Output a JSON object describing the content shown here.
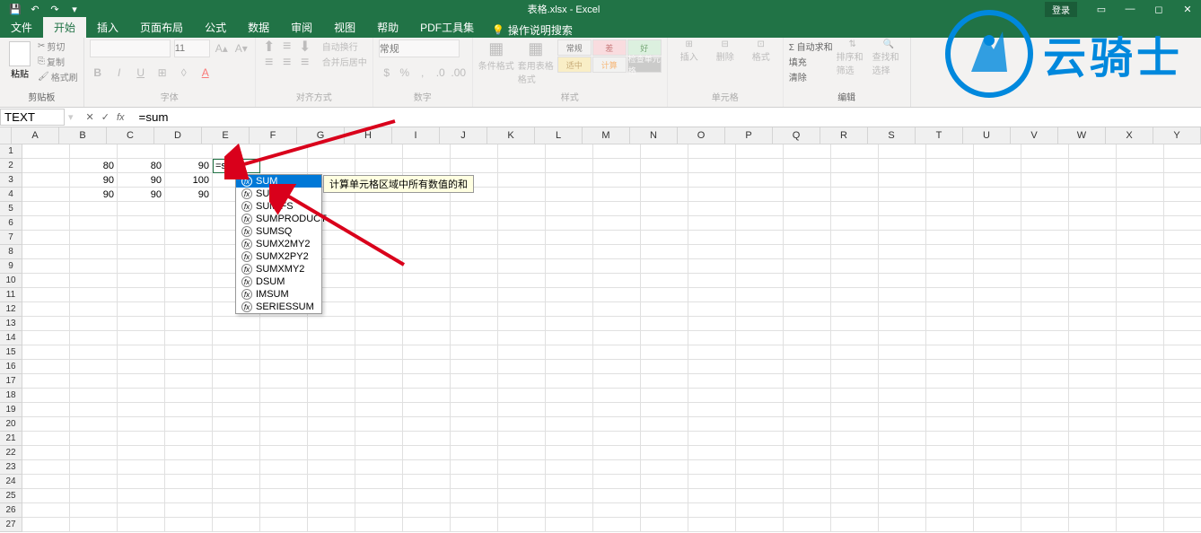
{
  "title": "表格.xlsx - Excel",
  "qat": {
    "save": "💾",
    "undo": "↶",
    "redo": "↷"
  },
  "login": "登录",
  "tabs": {
    "file": "文件",
    "home": "开始",
    "insert": "插入",
    "layout": "页面布局",
    "formulas": "公式",
    "data": "数据",
    "review": "审阅",
    "view": "视图",
    "help": "帮助",
    "pdf": "PDF工具集",
    "tellme": "操作说明搜索"
  },
  "ribbon": {
    "clipboard": {
      "label": "剪贴板",
      "paste": "粘贴",
      "cut": "剪切",
      "copy": "复制",
      "format": "格式刷"
    },
    "font": {
      "label": "字体",
      "size": "11"
    },
    "alignment": {
      "label": "对齐方式",
      "wrap": "自动换行",
      "merge": "合并后居中"
    },
    "number": {
      "label": "数字",
      "format": "常规"
    },
    "styles": {
      "label": "样式",
      "conditional": "条件格式",
      "table": "套用表格格式",
      "normal": "常规",
      "bad": "差",
      "good": "好",
      "neutral": "适中",
      "calc": "计算",
      "check": "检查单元格"
    },
    "cells": {
      "label": "单元格",
      "insert": "插入",
      "delete": "删除",
      "format": "格式"
    },
    "editing": {
      "label": "编辑",
      "sum": "Σ",
      "fill": "填充",
      "clear": "清除",
      "sort": "排序和筛选",
      "find": "查找和选择"
    }
  },
  "formula_bar": {
    "name_box": "TEXT",
    "formula": "=sum"
  },
  "columns": [
    "A",
    "B",
    "C",
    "D",
    "E",
    "F",
    "G",
    "H",
    "I",
    "J",
    "K",
    "L",
    "M",
    "N",
    "O",
    "P",
    "Q",
    "R",
    "S",
    "T",
    "U",
    "V",
    "W",
    "X",
    "Y"
  ],
  "rows": [
    1,
    2,
    3,
    4,
    5,
    6,
    7,
    8,
    9,
    10,
    11,
    12,
    13,
    14,
    15,
    16,
    17,
    18,
    19,
    20,
    21,
    22,
    23,
    24,
    25,
    26,
    27
  ],
  "grid_data": {
    "r2": {
      "B": "80",
      "C": "80",
      "D": "90",
      "E": "=sum"
    },
    "r3": {
      "B": "90",
      "C": "90",
      "D": "100"
    },
    "r4": {
      "B": "90",
      "C": "90",
      "D": "90"
    }
  },
  "active_cell_display": "=sum",
  "autocomplete": {
    "items": [
      "SUM",
      "SUMIF",
      "SUMIFS",
      "SUMPRODUCT",
      "SUMSQ",
      "SUMX2MY2",
      "SUMX2PY2",
      "SUMXMY2",
      "DSUM",
      "IMSUM",
      "SERIESSUM"
    ],
    "selected": "SUM",
    "tooltip": "计算单元格区域中所有数值的和"
  },
  "watermark": "云骑士"
}
